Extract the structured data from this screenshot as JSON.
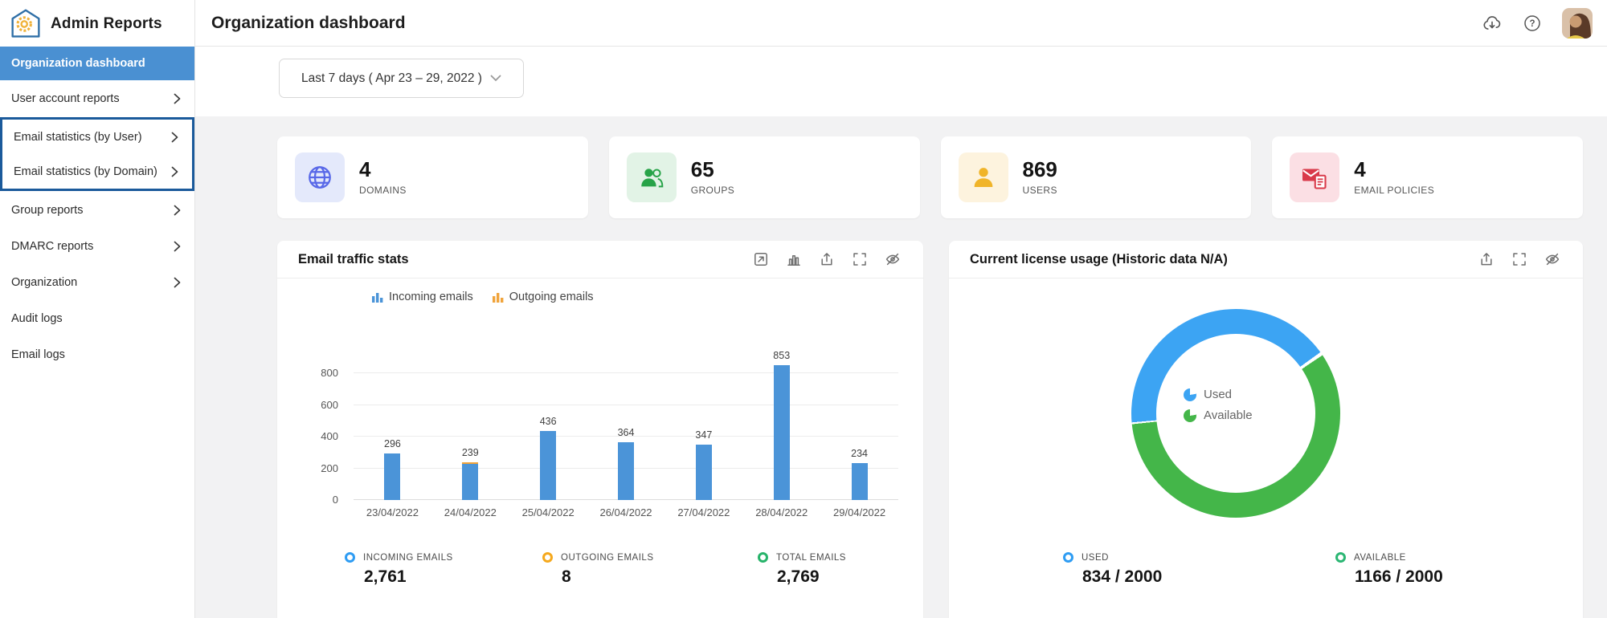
{
  "app": {
    "name": "Admin Reports"
  },
  "sidebar": {
    "items": [
      {
        "label": "Organization dashboard",
        "selected": true,
        "chevron": false,
        "boxed": false
      },
      {
        "label": "User account reports",
        "selected": false,
        "chevron": true,
        "boxed": false
      },
      {
        "label": "Email statistics (by User)",
        "selected": false,
        "chevron": true,
        "boxed": true
      },
      {
        "label": "Email statistics (by Domain)",
        "selected": false,
        "chevron": true,
        "boxed": true
      },
      {
        "label": "Group reports",
        "selected": false,
        "chevron": true,
        "boxed": false
      },
      {
        "label": "DMARC reports",
        "selected": false,
        "chevron": true,
        "boxed": false
      },
      {
        "label": "Organization",
        "selected": false,
        "chevron": true,
        "boxed": false
      },
      {
        "label": "Audit logs",
        "selected": false,
        "chevron": false,
        "boxed": false
      },
      {
        "label": "Email logs",
        "selected": false,
        "chevron": false,
        "boxed": false
      }
    ],
    "selected_bg": "#4a90d2",
    "highlight_box_color": "#1b5a9b"
  },
  "header": {
    "title": "Organization dashboard",
    "icons": [
      "cloud-download-icon",
      "help-icon",
      "avatar"
    ]
  },
  "filter": {
    "date_range_label": "Last 7 days ( Apr 23 – 29, 2022 )"
  },
  "summary_cards": [
    {
      "icon": "globe-icon",
      "value": "4",
      "label": "DOMAINS",
      "tile": "#e4e9fb",
      "accent": "#5868e8"
    },
    {
      "icon": "groups-icon",
      "value": "65",
      "label": "GROUPS",
      "tile": "#e2f3e6",
      "accent": "#27a348"
    },
    {
      "icon": "user-icon",
      "value": "869",
      "label": "USERS",
      "tile": "#fdf3de",
      "accent": "#f0b429"
    },
    {
      "icon": "email-policy-icon",
      "value": "4",
      "label": "EMAIL POLICIES",
      "tile": "#fbdfe4",
      "accent": "#d93a4a"
    }
  ],
  "email_traffic": {
    "title": "Email traffic stats",
    "toolbar_icons": [
      "open-in-new-icon",
      "chart-type-icon",
      "export-icon",
      "fullscreen-icon",
      "hide-icon"
    ],
    "legend": [
      {
        "label": "Incoming emails",
        "color": "#4b94d8"
      },
      {
        "label": "Outgoing emails",
        "color": "#f0a33a"
      }
    ],
    "chart_data": {
      "type": "bar",
      "stacked": true,
      "categories": [
        "23/04/2022",
        "24/04/2022",
        "25/04/2022",
        "26/04/2022",
        "27/04/2022",
        "28/04/2022",
        "29/04/2022"
      ],
      "series": [
        {
          "name": "Incoming emails",
          "color": "#4b94d8",
          "values": [
            296,
            231,
            436,
            364,
            347,
            853,
            234
          ]
        },
        {
          "name": "Outgoing emails",
          "color": "#f0a33a",
          "values": [
            0,
            8,
            0,
            0,
            0,
            0,
            0
          ]
        }
      ],
      "bar_labels": [
        "296",
        "239",
        "436",
        "364",
        "347",
        "853",
        "234"
      ],
      "yticks": [
        0,
        200,
        400,
        600,
        800
      ],
      "ylim": [
        0,
        900
      ],
      "grid": true,
      "legend_position": "top"
    },
    "totals": [
      {
        "label": "INCOMING EMAILS",
        "value": "2,761",
        "color": "#2e9cf3"
      },
      {
        "label": "OUTGOING EMAILS",
        "value": "8",
        "color": "#f5a81c"
      },
      {
        "label": "TOTAL EMAILS",
        "value": "2,769",
        "color": "#27b36a"
      }
    ]
  },
  "license_usage": {
    "title": "Current license usage (Historic data N/A)",
    "toolbar_icons": [
      "export-icon",
      "fullscreen-icon",
      "hide-icon"
    ],
    "chart_data": {
      "type": "pie",
      "labels": [
        "Used",
        "Available"
      ],
      "values": [
        834,
        1166
      ],
      "total": 2000,
      "colors": [
        "#3ca4f3",
        "#44b649"
      ],
      "donut": true,
      "legend_position": "center"
    },
    "legend": [
      {
        "label": "Used",
        "color": "#3ca4f3"
      },
      {
        "label": "Available",
        "color": "#44b649"
      }
    ],
    "totals": [
      {
        "label": "USED",
        "value": "834 / 2000",
        "color": "#2e9cf3"
      },
      {
        "label": "AVAILABLE",
        "value": "1166 / 2000",
        "color": "#2bb673"
      }
    ]
  }
}
